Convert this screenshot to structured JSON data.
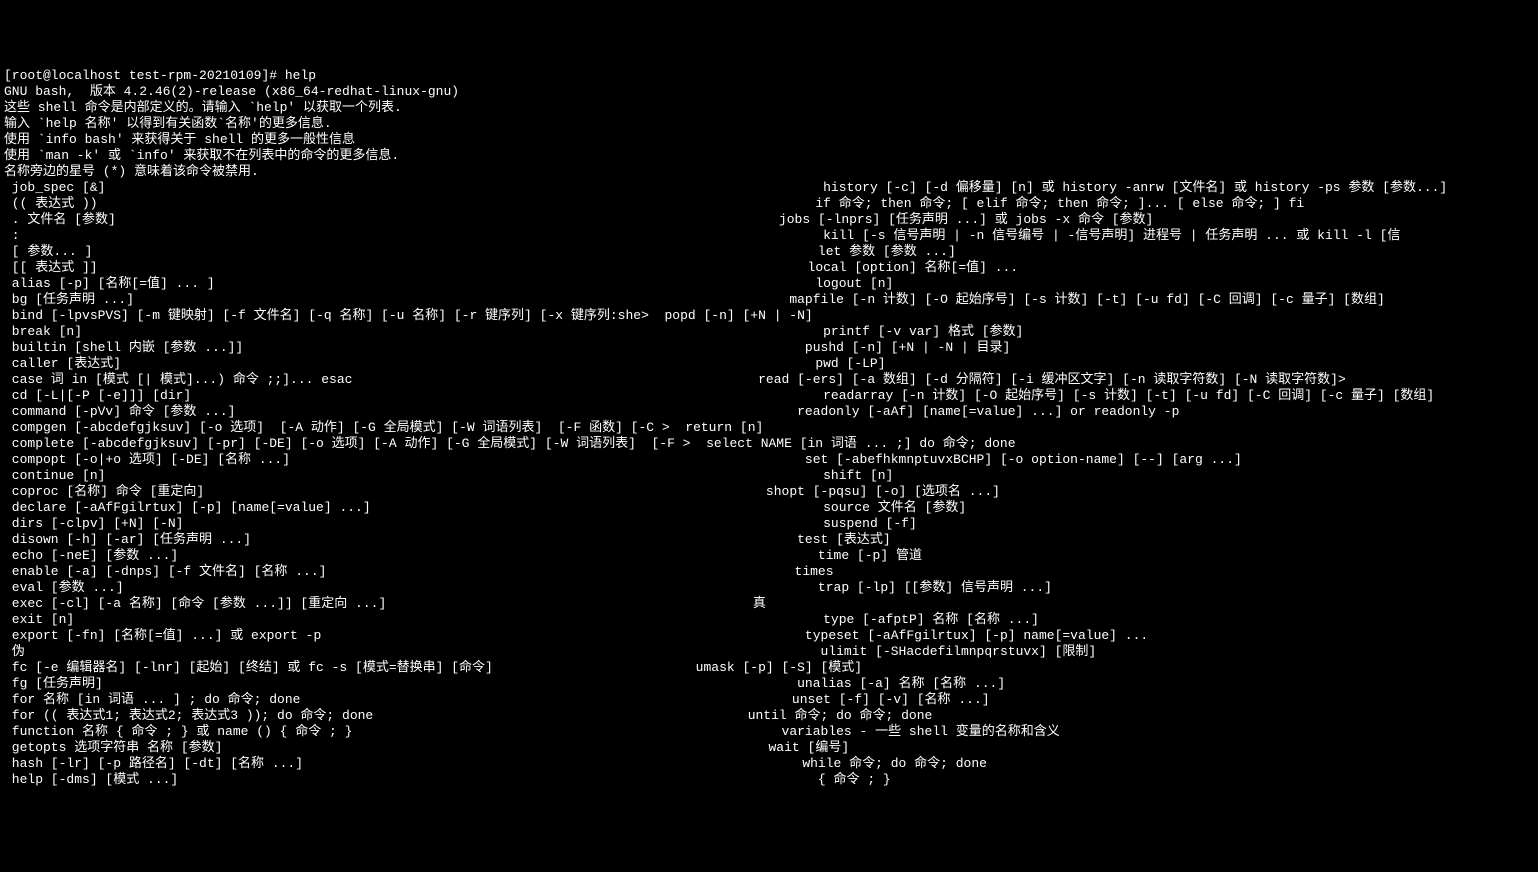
{
  "prompt_line": "[root@localhost test-rpm-20210109]# help",
  "header_lines": [
    "GNU bash,  版本 4.2.46(2)-release (x86_64-redhat-linux-gnu)",
    "这些 shell 命令是内部定义的。请输入 `help' 以获取一个列表.",
    "输入 `help 名称' 以得到有关函数`名称'的更多信息.",
    "使用 `info bash' 来获得关于 shell 的更多一般性信息",
    "使用 `man -k' 或 `info' 来获取不在列表中的命令的更多信息.",
    "",
    "名称旁边的星号 (*) 意味着该命令被禁用.",
    ""
  ],
  "help_lines": [
    " job_spec [&]                                                                                            history [-c] [-d 偏移量] [n] 或 history -anrw [文件名] 或 history -ps 参数 [参数...]",
    " (( 表达式 ))                                                                                            if 命令; then 命令; [ elif 命令; then 命令; ]... [ else 命令; ] fi",
    " . 文件名 [参数]                                                                                     jobs [-lnprs] [任务声明 ...] 或 jobs -x 命令 [参数]",
    " :                                                                                                       kill [-s 信号声明 | -n 信号编号 | -信号声明] 进程号 | 任务声明 ... 或 kill -l [信",
    " [ 参数... ]                                                                                             let 参数 [参数 ...]",
    " [[ 表达式 ]]                                                                                           local [option] 名称[=值] ...",
    " alias [-p] [名称[=值] ... ]                                                                             logout [n]",
    " bg [任务声明 ...]                                                                                    mapfile [-n 计数] [-O 起始序号] [-s 计数] [-t] [-u fd] [-C 回调] [-c 量子] [数组]",
    " bind [-lpvsPVS] [-m 键映射] [-f 文件名] [-q 名称] [-u 名称] [-r 键序列] [-x 键序列:she>  popd [-n] [+N | -N]",
    " break [n]                                                                                               printf [-v var] 格式 [参数]",
    " builtin [shell 内嵌 [参数 ...]]                                                                        pushd [-n] [+N | -N | 目录]",
    " caller [表达式]                                                                                         pwd [-LP]",
    " case 词 in [模式 [| 模式]...) 命令 ;;]... esac                                                    read [-ers] [-a 数组] [-d 分隔符] [-i 缓冲区文字] [-n 读取字符数] [-N 读取字符数]>",
    " cd [-L|[-P [-e]]] [dir]                                                                                 readarray [-n 计数] [-O 起始序号] [-s 计数] [-t] [-u fd] [-C 回调] [-c 量子] [数组]",
    " command [-pVv] 命令 [参数 ...]                                                                        readonly [-aAf] [name[=value] ...] or readonly -p",
    " compgen [-abcdefgjksuv] [-o 选项]  [-A 动作] [-G 全局模式] [-W 词语列表]  [-F 函数] [-C >  return [n]",
    " complete [-abcdefgjksuv] [-pr] [-DE] [-o 选项] [-A 动作] [-G 全局模式] [-W 词语列表]  [-F >  select NAME [in 词语 ... ;] do 命令; done",
    " compopt [-o|+o 选项] [-DE] [名称 ...]                                                                  set [-abefhkmnptuvxBCHP] [-o option-name] [--] [arg ...]",
    " continue [n]                                                                                            shift [n]",
    " coproc [名称] 命令 [重定向]                                                                        shopt [-pqsu] [-o] [选项名 ...]",
    " declare [-aAfFgilrtux] [-p] [name[=value] ...]                                                          source 文件名 [参数]",
    " dirs [-clpv] [+N] [-N]                                                                                  suspend [-f]",
    " disown [-h] [-ar] [任务声明 ...]                                                                      test [表达式]",
    " echo [-neE] [参数 ...]                                                                                  time [-p] 管道",
    " enable [-a] [-dnps] [-f 文件名] [名称 ...]                                                            times",
    " eval [参数 ...]                                                                                         trap [-lp] [[参数] 信号声明 ...]",
    " exec [-cl] [-a 名称] [命令 [参数 ...]] [重定向 ...]                                               真",
    " exit [n]                                                                                                type [-afptP] 名称 [名称 ...]",
    " export [-fn] [名称[=值] ...] 或 export -p                                                              typeset [-aAfFgilrtux] [-p] name[=value] ...",
    " 伪                                                                                                      ulimit [-SHacdefilmnpqrstuvx] [限制]",
    " fc [-e 编辑器名] [-lnr] [起始] [终结] 或 fc -s [模式=替换串] [命令]                          umask [-p] [-S] [模式]",
    " fg [任务声明]                                                                                         unalias [-a] 名称 [名称 ...]",
    " for 名称 [in 词语 ... ] ; do 命令; done                                                               unset [-f] [-v] [名称 ...]",
    " for (( 表达式1; 表达式2; 表达式3 )); do 命令; done                                                until 命令; do 命令; done",
    " function 名称 { 命令 ; } 或 name () { 命令 ; }                                                       variables - 一些 shell 变量的名称和含义",
    " getopts 选项字符串 名称 [参数]                                                                      wait [编号]",
    " hash [-lr] [-p 路径名] [-dt] [名称 ...]                                                                while 命令; do 命令; done",
    " help [-dms] [模式 ...]                                                                                  { 命令 ; }"
  ]
}
